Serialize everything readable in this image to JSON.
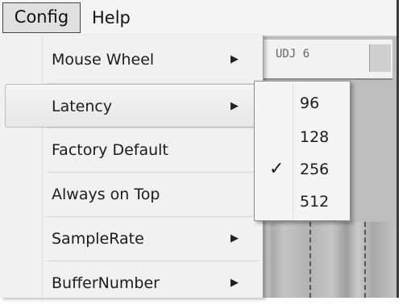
{
  "menubar": {
    "config_label": "Config",
    "help_label": "Help"
  },
  "background": {
    "deck_label": "UDJ 6"
  },
  "config_menu": {
    "items": [
      {
        "label": "Mouse Wheel",
        "has_submenu": true
      },
      {
        "label": "Latency",
        "has_submenu": true,
        "highlighted": true
      },
      {
        "label": "Factory Default",
        "has_submenu": false
      },
      {
        "label": "Always on Top",
        "has_submenu": false
      },
      {
        "label": "SampleRate",
        "has_submenu": true
      },
      {
        "label": "BufferNumber",
        "has_submenu": true
      }
    ],
    "submenu_arrow_icon": "triangle-right-icon"
  },
  "latency_submenu": {
    "items": [
      {
        "label": "96",
        "checked": false
      },
      {
        "label": "128",
        "checked": false
      },
      {
        "label": "256",
        "checked": true
      },
      {
        "label": "512",
        "checked": false
      }
    ],
    "check_glyph": "✓"
  }
}
